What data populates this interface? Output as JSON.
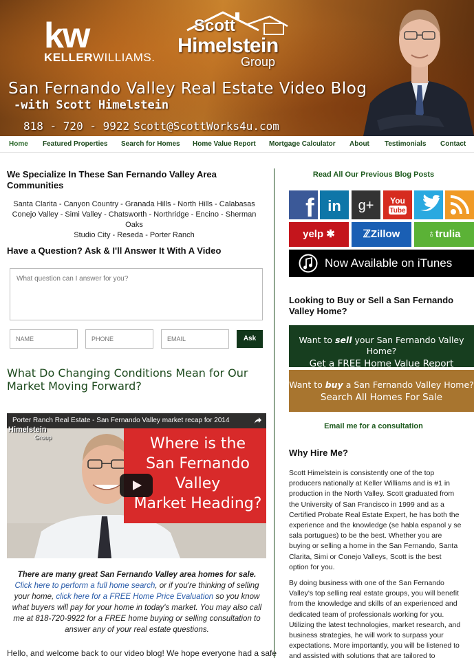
{
  "header": {
    "kw_mark": "kw",
    "kw_name_1": "KELLER",
    "kw_name_2": "WILLIAMS.",
    "group_scott": "Scott",
    "group_himelstein": "Himelstein",
    "group_group": "Group",
    "blog_title": "San Fernando Valley Real Estate Video Blog",
    "blog_subtitle": "-with Scott Himelstein",
    "phone": "818 - 720 - 9922",
    "email": "Scott@ScottWorks4u.com"
  },
  "nav": {
    "items": [
      {
        "label": "Home"
      },
      {
        "label": "Featured Properties"
      },
      {
        "label": "Search for Homes"
      },
      {
        "label": "Home Value Report"
      },
      {
        "label": "Mortgage Calculator"
      },
      {
        "label": "About"
      },
      {
        "label": "Testimonials"
      },
      {
        "label": "Contact"
      }
    ]
  },
  "specialize": {
    "heading": "We Specialize In These San Fernando Valley Area Communities",
    "areas_line1": "Santa Clarita - Canyon Country - Granada Hills - North Hills - Calabasas",
    "areas_line2": "Conejo Valley - Simi Valley - Chatsworth - Northridge - Encino - Sherman Oaks",
    "areas_line3": "Studio City - Reseda - Porter Ranch"
  },
  "question_form": {
    "heading": "Have a Question? Ask & I'll Answer It With A Video",
    "question_placeholder": "What question can I answer for you?",
    "name_placeholder": "NAME",
    "phone_placeholder": "PHONE",
    "email_placeholder": "EMAIL",
    "submit_label": "Ask"
  },
  "post": {
    "title": "What Do Changing Conditions Mean for Our Market Moving Forward?",
    "video": {
      "title": "Porter Ranch Real Estate - San Fernando Valley market recap for 2014",
      "overlay_line1": "Where is the",
      "overlay_line2": "San Fernando Valley",
      "overlay_line3": "Market Heading?",
      "logo_himelstein": "Himelstein",
      "logo_group": "Group"
    },
    "intro_bold": "There are many great San Fernando Valley area homes for sale.",
    "intro_link1": "Click here to perform a full home search",
    "intro_mid1": ", or if you're thinking of selling your home,",
    "intro_link2": "click here for a FREE Home Price Evaluation",
    "intro_mid2": "so you know what buyers will pay for your home in today's market. You may also call me at 818-720-9922 for a FREE home buying or selling consultation to answer any of your real estate questions.",
    "hello": "Hello, and welcome back to our video blog! We hope everyone had a safe"
  },
  "sidebar": {
    "read_all": "Read All Our Previous Blog Posts",
    "social": {
      "facebook": "f",
      "linkedin": "in",
      "googleplus": "g+",
      "youtube_you": "You",
      "youtube_tube": "Tube",
      "yelp": "yelp",
      "zillow": "Zillow",
      "trulia": "trulia"
    },
    "itunes": "Now Available on iTunes",
    "look_heading": "Looking to Buy or Sell a San Fernando Valley Home?",
    "cta_sell_prefix": "Want to ",
    "cta_sell_em": "sell",
    "cta_sell_suffix": " your San Fernando Valley Home?",
    "cta_sell_line2": "Get a FREE Home Value Report",
    "cta_buy_prefix": "Want to ",
    "cta_buy_em": "buy",
    "cta_buy_suffix": " a San Fernando Valley Home?",
    "cta_buy_line2": "Search All Homes For Sale",
    "consult": "Email me for a consultation",
    "why_heading": "Why Hire Me?",
    "why_p1": "Scott Himelstein is consistently one of the top producers nationally at Keller Williams and is #1 in production in the North Valley. Scott graduated from the University of San Francisco in 1999 and as a Certified Probate Real Estate Expert, he has both the experience and the knowledge (se habla espanol y se sala portugues) to be the best. Whether you are buying or selling a home in the San Fernando, Santa Clarita, Simi or Conejo Valleys, Scott is the best option for you.",
    "why_p2": "By doing business with one of the San Fernando Valley's top selling real estate groups, you will benefit from the knowledge and skills of an experienced and dedicated team of professionals working for you. Utilizing the latest technologies, market research, and business strategies, he will work to surpass your expectations. More importantly, you will be listened to and assisted with solutions that are tailored to"
  },
  "colors": {
    "nav_text": "#1d4a1d",
    "accent_green": "#173e1f",
    "accent_gold": "#a8752f",
    "link_blue": "#2659a8",
    "facebook": "#3b5998",
    "linkedin": "#0e76a8",
    "googleplus": "#333333",
    "youtube": "#d62b1f",
    "twitter": "#2aa9e0",
    "rss": "#f09a26",
    "yelp": "#c4151c",
    "zillow": "#1a5fb4",
    "trulia": "#5bb236"
  }
}
